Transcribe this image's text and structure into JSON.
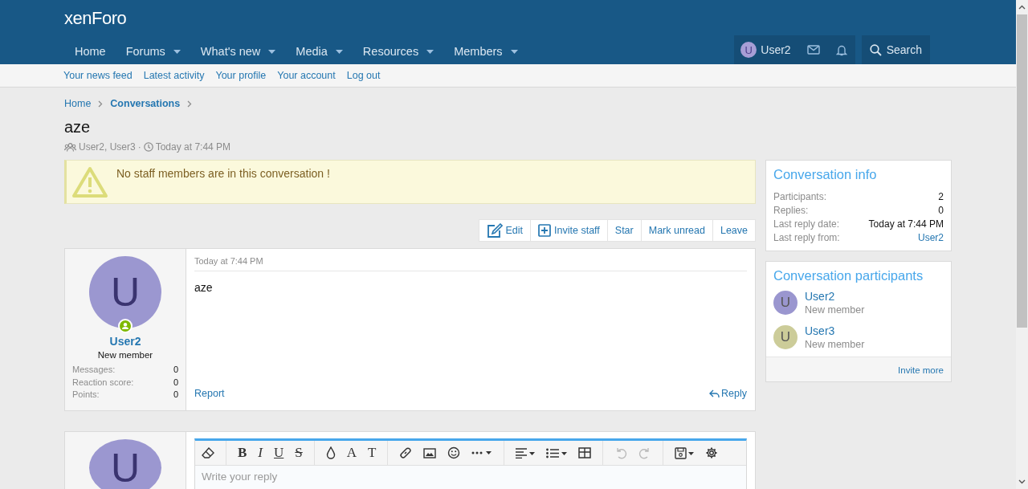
{
  "header": {
    "logo": "xenForo",
    "nav": [
      {
        "label": "Home",
        "dropdown": false,
        "selected": false
      },
      {
        "label": "Forums",
        "dropdown": true,
        "selected": false
      },
      {
        "label": "What's new",
        "dropdown": true,
        "selected": false
      },
      {
        "label": "Media",
        "dropdown": true,
        "selected": false
      },
      {
        "label": "Resources",
        "dropdown": true,
        "selected": false
      },
      {
        "label": "Members",
        "dropdown": true,
        "selected": false
      }
    ],
    "user": {
      "avatar_letter": "U",
      "name": "User2"
    },
    "search": "Search"
  },
  "subnav": [
    "Your news feed",
    "Latest activity",
    "Your profile",
    "Your account",
    "Log out"
  ],
  "breadcrumbs": [
    {
      "label": "Home",
      "current": false
    },
    {
      "label": "Conversations",
      "current": true
    }
  ],
  "title": "aze",
  "meta": {
    "participants": "User2, User3",
    "separator": "·",
    "time": "Today at 7:44 PM"
  },
  "notice": "No staff members are in this conversation !",
  "actions": [
    {
      "label": "Edit",
      "kind": "edit"
    },
    {
      "label": "Invite staff",
      "kind": "invite"
    },
    {
      "label": "Star",
      "kind": "plain"
    },
    {
      "label": "Mark unread",
      "kind": "plain"
    },
    {
      "label": "Leave",
      "kind": "plain"
    }
  ],
  "message": {
    "avatar_letter": "U",
    "online": true,
    "user": "User2",
    "role": "New member",
    "stats": [
      {
        "label": "Messages:",
        "value": "0"
      },
      {
        "label": "Reaction score:",
        "value": "0"
      },
      {
        "label": "Points:",
        "value": "0"
      }
    ],
    "time": "Today at 7:44 PM",
    "body": "aze",
    "report": "Report",
    "reply": "Reply"
  },
  "editor": {
    "avatar_letter": "U",
    "letters": [
      "B",
      "I",
      "U",
      "S",
      "A",
      "T"
    ],
    "placeholder": "Write your reply"
  },
  "info": {
    "title": "Conversation info",
    "rows": [
      {
        "label": "Participants:",
        "value": "2",
        "link": false
      },
      {
        "label": "Replies:",
        "value": "0",
        "link": false
      },
      {
        "label": "Last reply date:",
        "value": "Today at 7:44 PM",
        "link": false
      },
      {
        "label": "Last reply from:",
        "value": "User2",
        "link": true
      }
    ]
  },
  "participants": {
    "title": "Conversation participants",
    "items": [
      {
        "letter": "U",
        "name": "User2",
        "role": "New member",
        "color": "#9a96cf"
      },
      {
        "letter": "U",
        "name": "User3",
        "role": "New member",
        "color": "#cccc99"
      }
    ],
    "footer": "Invite more"
  }
}
